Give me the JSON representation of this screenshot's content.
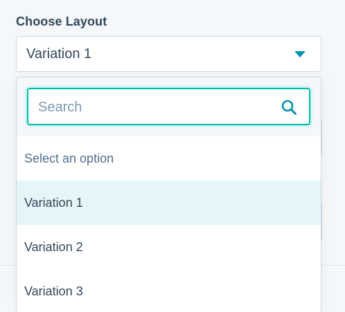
{
  "field": {
    "label": "Choose Layout",
    "selected_value": "Variation 1"
  },
  "dropdown": {
    "search_placeholder": "Search",
    "search_value": "",
    "options": [
      {
        "label": "Select an option",
        "placeholder": true
      },
      {
        "label": "Variation 1",
        "selected": true
      },
      {
        "label": "Variation 2"
      },
      {
        "label": "Variation 3"
      }
    ]
  },
  "colors": {
    "accent": "#0091ae",
    "focus_border": "#00bda5",
    "selected_bg": "#e5f5f8",
    "text": "#33475b"
  },
  "icons": {
    "caret": "caret-down-icon",
    "search": "search-icon"
  }
}
